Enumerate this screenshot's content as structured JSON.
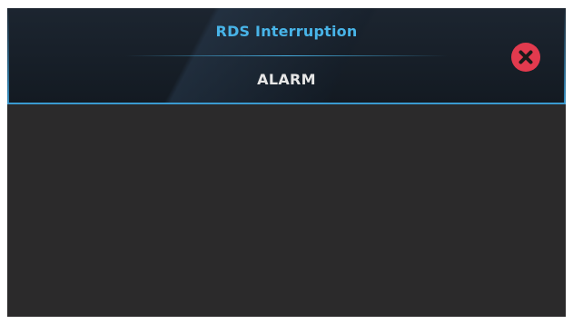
{
  "dialog": {
    "title": "RDS Interruption",
    "subtitle": "ALARM",
    "close_icon": "close-x-icon"
  },
  "colors": {
    "title": "#48b4e8",
    "accent_border": "#3a9ad0",
    "subtitle": "#e6e6e6",
    "close_button": "#e23a4e",
    "background": "#2b2a2b",
    "header": "#161e27"
  }
}
